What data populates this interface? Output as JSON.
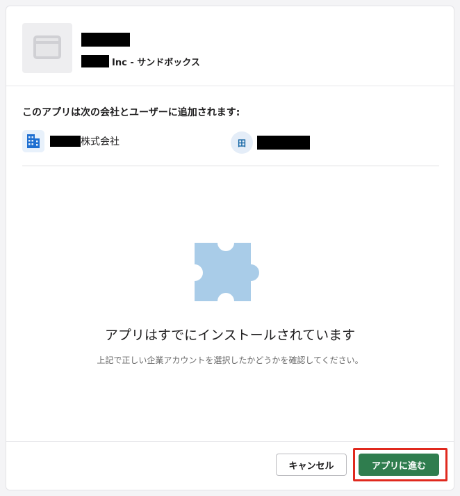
{
  "app": {
    "workspace_suffix": "Inc - サンドボックス"
  },
  "target": {
    "heading": "このアプリは次の会社とユーザーに追加されます:",
    "company_suffix": "株式会社",
    "user_avatar_initial": "田"
  },
  "status": {
    "title": "アプリはすでにインストールされています",
    "subtitle": "上記で正しい企業アカウントを選択したかどうかを確認してください。"
  },
  "footer": {
    "cancel_label": "キャンセル",
    "proceed_label": "アプリに進む"
  },
  "icons": {
    "app_placeholder": "app-window-icon",
    "company": "building-icon",
    "illustration": "puzzle-piece-icon"
  },
  "colors": {
    "proceed_button": "#2f7d4e",
    "highlight_frame": "#e0291e",
    "company_icon": "#1e6fd1",
    "puzzle": "#a9cce8"
  }
}
